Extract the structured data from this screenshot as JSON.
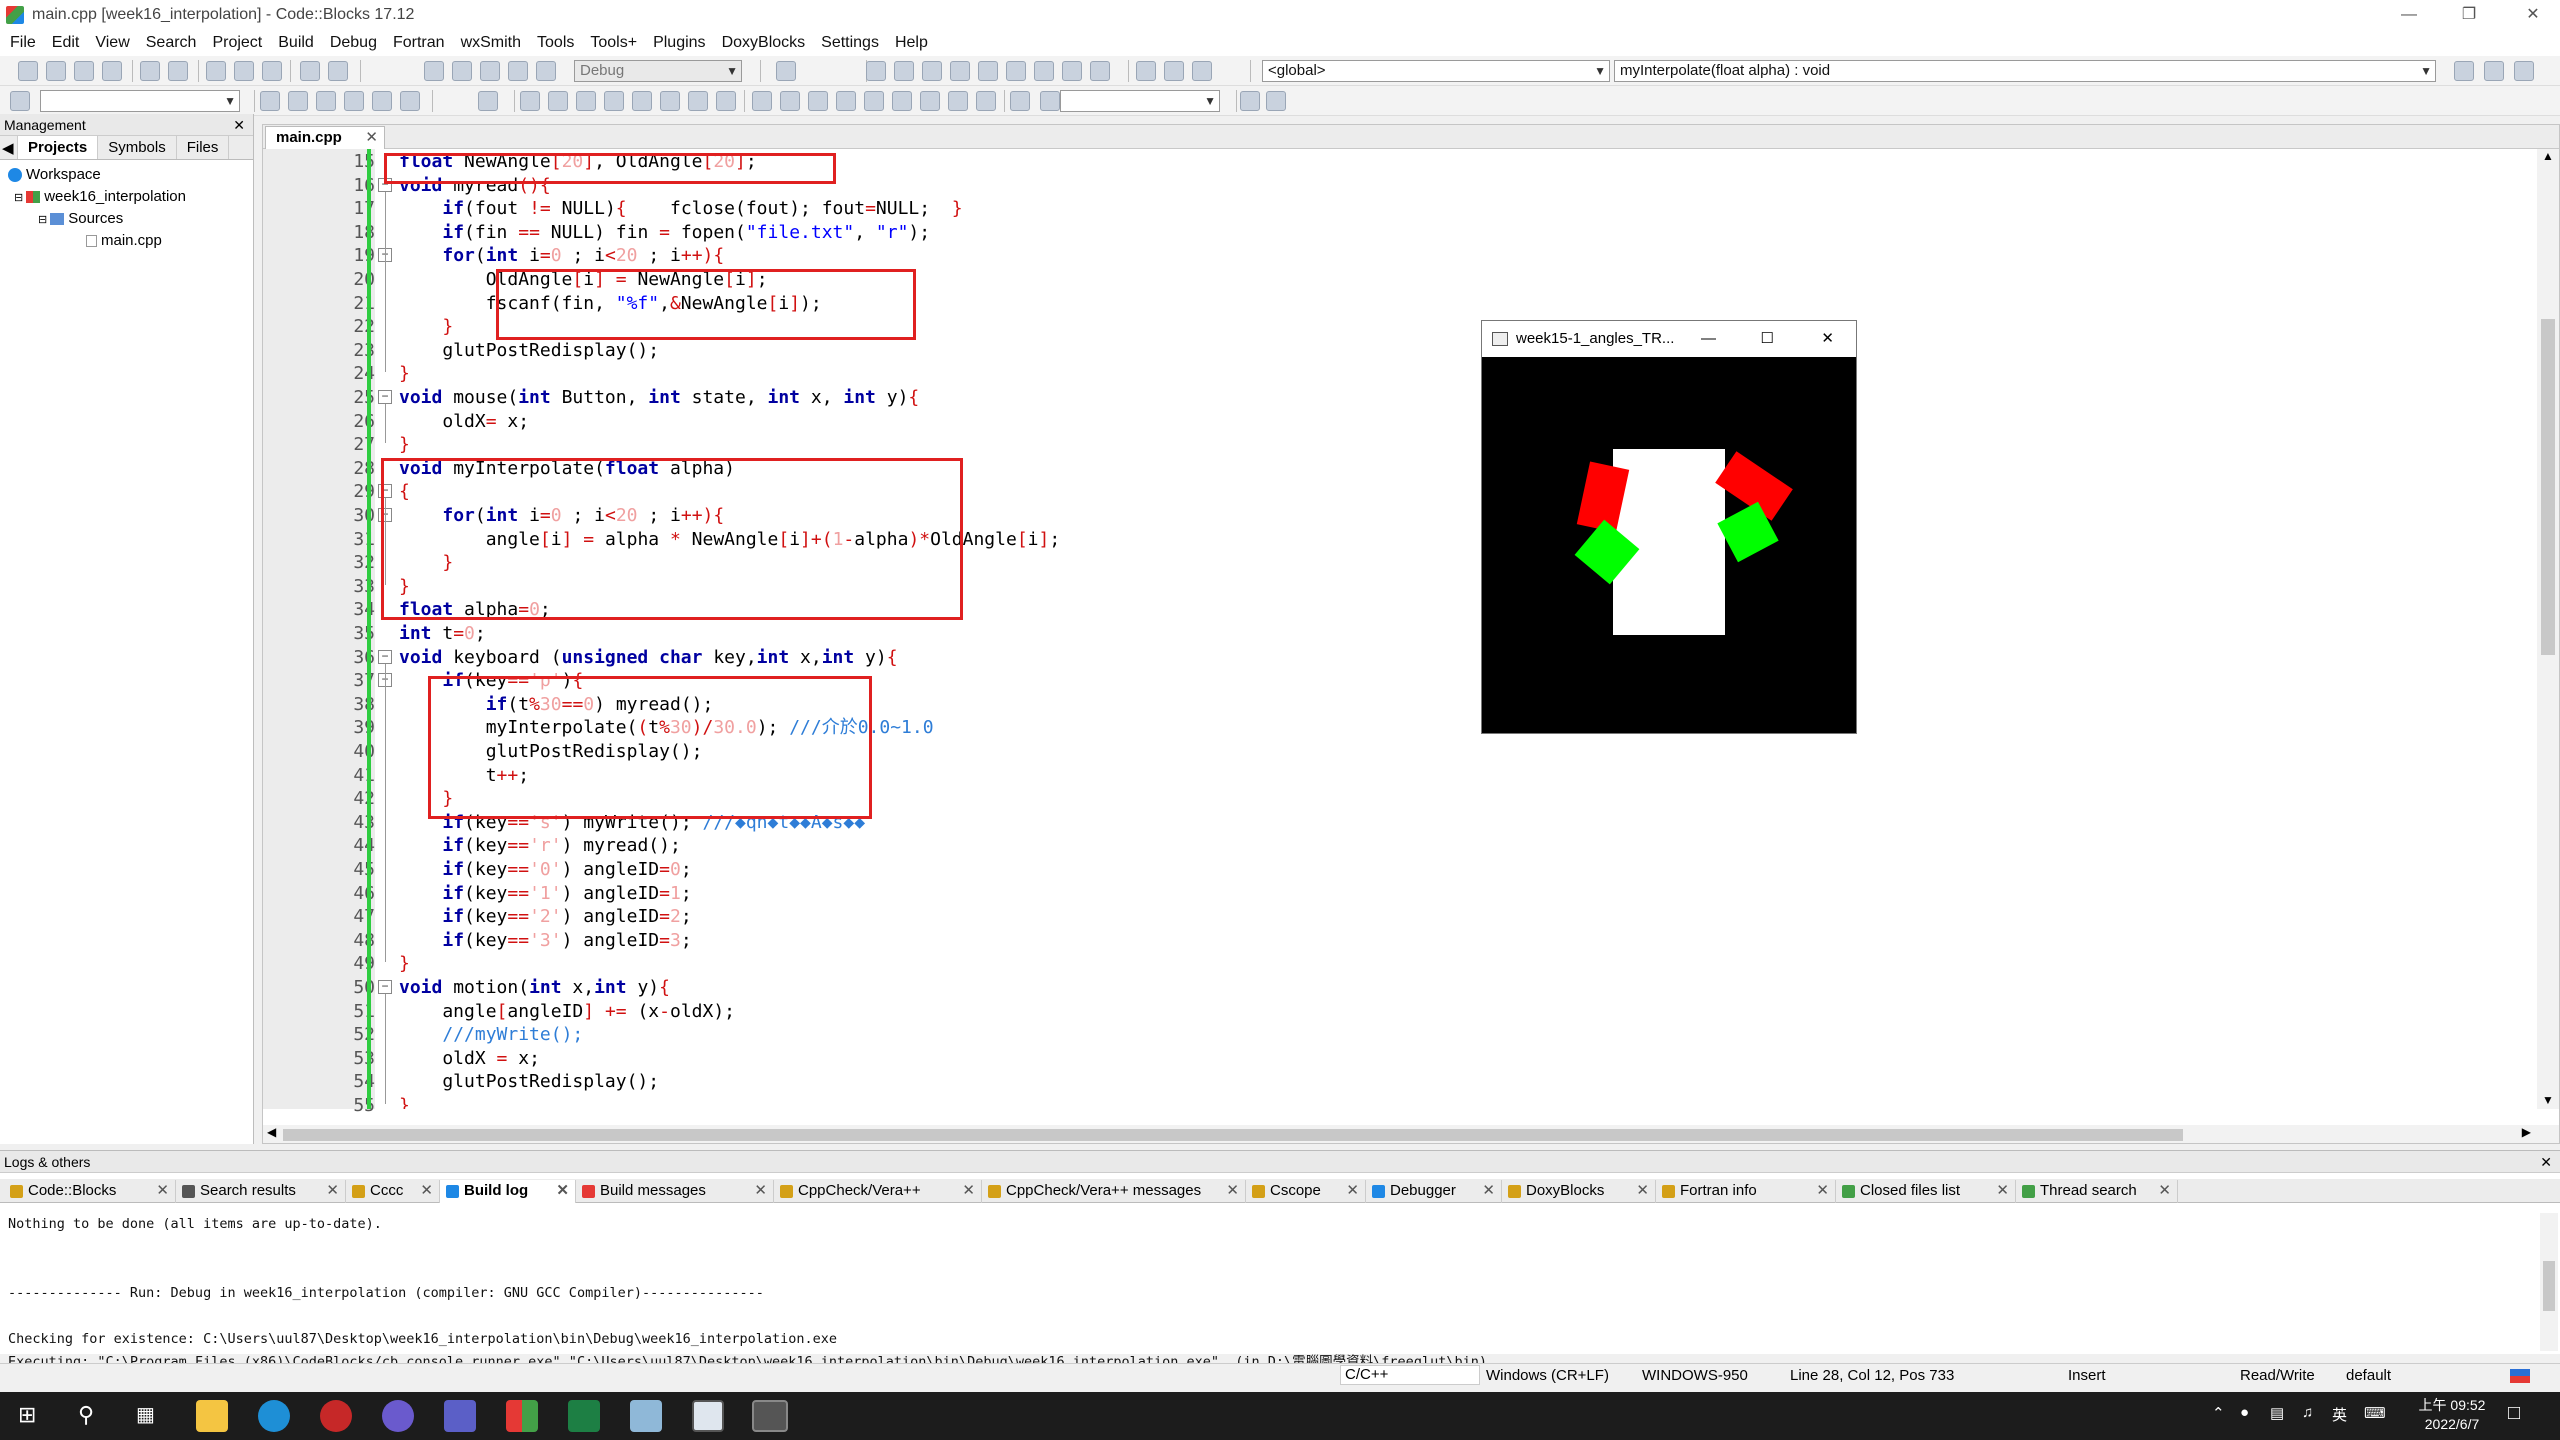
{
  "window": {
    "title": "main.cpp [week16_interpolation] - Code::Blocks 17.12"
  },
  "menu": [
    "File",
    "Edit",
    "View",
    "Search",
    "Project",
    "Build",
    "Debug",
    "Fortran",
    "wxSmith",
    "Tools",
    "Tools+",
    "Plugins",
    "DoxyBlocks",
    "Settings",
    "Help"
  ],
  "toolbar": {
    "build_target": "Debug",
    "scope": "<global>",
    "function": "myInterpolate(float alpha) : void"
  },
  "management": {
    "title": "Management",
    "tabs": [
      "Projects",
      "Symbols",
      "Files"
    ],
    "tree": {
      "workspace": "Workspace",
      "project": "week16_interpolation",
      "folder": "Sources",
      "file": "main.cpp"
    }
  },
  "editor": {
    "tab": "main.cpp",
    "lines": [
      {
        "n": "15",
        "html": "<span class='kw'>float</span> NewAngle<span class='op'>[</span><span class='num'>20</span><span class='op'>]</span>, OldAngle<span class='op'>[</span><span class='num'>20</span><span class='op'>]</span>;"
      },
      {
        "n": "16",
        "html": "<span class='kw'>void</span> myread<span class='op'>(){</span>"
      },
      {
        "n": "17",
        "html": "    <span class='kw'>if</span>(fout <span class='op'>!=</span> NULL)<span class='op'>{</span>    fclose(fout); fout<span class='op'>=</span>NULL;  <span class='op'>}</span>"
      },
      {
        "n": "18",
        "html": "    <span class='kw'>if</span>(fin <span class='op'>==</span> NULL) fin <span class='op'>=</span> fopen(<span class='str'>\"file.txt\"</span>, <span class='str'>\"r\"</span>);"
      },
      {
        "n": "19",
        "html": "    <span class='kw'>for</span>(<span class='kw'>int</span> i<span class='op'>=</span><span class='num'>0</span> ; i<span class='op'>&lt;</span><span class='num'>20</span> ; i<span class='op'>++){</span>"
      },
      {
        "n": "20",
        "html": "        OldAngle<span class='op'>[</span>i<span class='op'>]</span> <span class='op'>=</span> NewAngle<span class='op'>[</span>i<span class='op'>]</span>;"
      },
      {
        "n": "21",
        "html": "        fscanf(fin, <span class='str'>\"%f\"</span>,<span class='op'>&amp;</span>NewAngle<span class='op'>[</span>i<span class='op'>]</span>);"
      },
      {
        "n": "22",
        "html": "    <span class='op'>}</span>"
      },
      {
        "n": "23",
        "html": "    glutPostRedisplay();"
      },
      {
        "n": "24",
        "html": "<span class='op'>}</span>"
      },
      {
        "n": "25",
        "html": "<span class='kw'>void</span> mouse(<span class='kw'>int</span> Button, <span class='kw'>int</span> state, <span class='kw'>int</span> x, <span class='kw'>int</span> y)<span class='op'>{</span>"
      },
      {
        "n": "26",
        "html": "    oldX<span class='op'>=</span> x;"
      },
      {
        "n": "27",
        "html": "<span class='op'>}</span>"
      },
      {
        "n": "28",
        "html": "<span class='kw'>void</span> myInterpolate(<span class='kw'>float</span> alpha)"
      },
      {
        "n": "29",
        "html": "<span class='op'>{</span>"
      },
      {
        "n": "30",
        "html": "    <span class='kw'>for</span>(<span class='kw'>int</span> i<span class='op'>=</span><span class='num'>0</span> ; i<span class='op'>&lt;</span><span class='num'>20</span> ; i<span class='op'>++){</span>"
      },
      {
        "n": "31",
        "html": "        angle<span class='op'>[</span>i<span class='op'>]</span> <span class='op'>=</span> alpha <span class='op'>*</span> NewAngle<span class='op'>[</span>i<span class='op'>]+(</span><span class='num'>1</span><span class='op'>-</span>alpha<span class='op'>)*</span>OldAngle<span class='op'>[</span>i<span class='op'>]</span>;"
      },
      {
        "n": "32",
        "html": "    <span class='op'>}</span>"
      },
      {
        "n": "33",
        "html": "<span class='op'>}</span>"
      },
      {
        "n": "34",
        "html": "<span class='kw'>float</span> alpha<span class='op'>=</span><span class='num'>0</span>;"
      },
      {
        "n": "35",
        "html": "<span class='kw'>int</span> t<span class='op'>=</span><span class='num'>0</span>;"
      },
      {
        "n": "36",
        "html": "<span class='kw'>void</span> keyboard (<span class='kw'>unsigned</span> <span class='kw'>char</span> key,<span class='kw'>int</span> x,<span class='kw'>int</span> y)<span class='op'>{</span>"
      },
      {
        "n": "37",
        "html": "    <span class='kw'>if</span>(key<span class='op'>==</span><span class='num'>'p'</span>)<span class='op'>{</span>"
      },
      {
        "n": "38",
        "html": "        <span class='kw'>if</span>(t<span class='op'>%</span><span class='num'>30</span><span class='op'>==</span><span class='num'>0</span>) myread();"
      },
      {
        "n": "39",
        "html": "        myInterpolate(<span class='op'>(</span>t<span class='op'>%</span><span class='num'>30</span><span class='op'>)/</span><span class='num'>30.0</span>); <span class='cmt'>///介於0.0~1.0</span>"
      },
      {
        "n": "40",
        "html": "        glutPostRedisplay();"
      },
      {
        "n": "41",
        "html": "        t<span class='op'>++</span>;"
      },
      {
        "n": "42",
        "html": "    <span class='op'>}</span>"
      },
      {
        "n": "43",
        "html": "    <span class='kw'>if</span>(key<span class='op'>==</span><span class='num'>'s'</span>) myWrite(); <span class='cmt'>///◆qn◆t◆◆A◆s◆◆</span>"
      },
      {
        "n": "44",
        "html": "    <span class='kw'>if</span>(key<span class='op'>==</span><span class='num'>'r'</span>) myread();"
      },
      {
        "n": "45",
        "html": "    <span class='kw'>if</span>(key<span class='op'>==</span><span class='num'>'0'</span>) angleID<span class='op'>=</span><span class='num'>0</span>;"
      },
      {
        "n": "46",
        "html": "    <span class='kw'>if</span>(key<span class='op'>==</span><span class='num'>'1'</span>) angleID<span class='op'>=</span><span class='num'>1</span>;"
      },
      {
        "n": "47",
        "html": "    <span class='kw'>if</span>(key<span class='op'>==</span><span class='num'>'2'</span>) angleID<span class='op'>=</span><span class='num'>2</span>;"
      },
      {
        "n": "48",
        "html": "    <span class='kw'>if</span>(key<span class='op'>==</span><span class='num'>'3'</span>) angleID<span class='op'>=</span><span class='num'>3</span>;"
      },
      {
        "n": "49",
        "html": "<span class='op'>}</span>"
      },
      {
        "n": "50",
        "html": "<span class='kw'>void</span> motion(<span class='kw'>int</span> x,<span class='kw'>int</span> y)<span class='op'>{</span>"
      },
      {
        "n": "51",
        "html": "    angle<span class='op'>[</span>angleID<span class='op'>]</span> <span class='op'>+=</span> (x<span class='op'>-</span>oldX);"
      },
      {
        "n": "52",
        "html": "    <span class='cmt'>///myWrite();</span>"
      },
      {
        "n": "53",
        "html": "    oldX <span class='op'>=</span> x;"
      },
      {
        "n": "54",
        "html": "    glutPostRedisplay();"
      },
      {
        "n": "55",
        "html": "<span class='op'>}</span>"
      }
    ]
  },
  "glwindow": {
    "title": "week15-1_angles_TR..."
  },
  "logs": {
    "title": "Logs & others",
    "tabs": [
      "Code::Blocks",
      "Search results",
      "Cccc",
      "Build log",
      "Build messages",
      "CppCheck/Vera++",
      "CppCheck/Vera++ messages",
      "Cscope",
      "Debugger",
      "DoxyBlocks",
      "Fortran info",
      "Closed files list",
      "Thread search"
    ],
    "active_tab": "Build log",
    "lines": [
      "Nothing to be done (all items are up-to-date).",
      "",
      "",
      "-------------- Run: Debug in week16_interpolation (compiler: GNU GCC Compiler)---------------",
      "",
      "Checking for existence: C:\\Users\\uul87\\Desktop\\week16_interpolation\\bin\\Debug\\week16_interpolation.exe",
      "Executing: \"C:\\Program Files (x86)\\CodeBlocks/cb_console_runner.exe\" \"C:\\Users\\uul87\\Desktop\\week16_interpolation\\bin\\Debug\\week16_interpolation.exe\"  (in D:\\電腦圖學資料\\freeglut\\bin)"
    ]
  },
  "status": {
    "lang": "C/C++",
    "eol": "Windows (CR+LF)",
    "encoding": "WINDOWS-950",
    "position": "Line 28, Col 12, Pos 733",
    "mode": "Insert",
    "access": "Read/Write",
    "profile": "default"
  },
  "taskbar": {
    "ime": "英",
    "time": "上午 09:52",
    "date": "2022/6/7"
  }
}
